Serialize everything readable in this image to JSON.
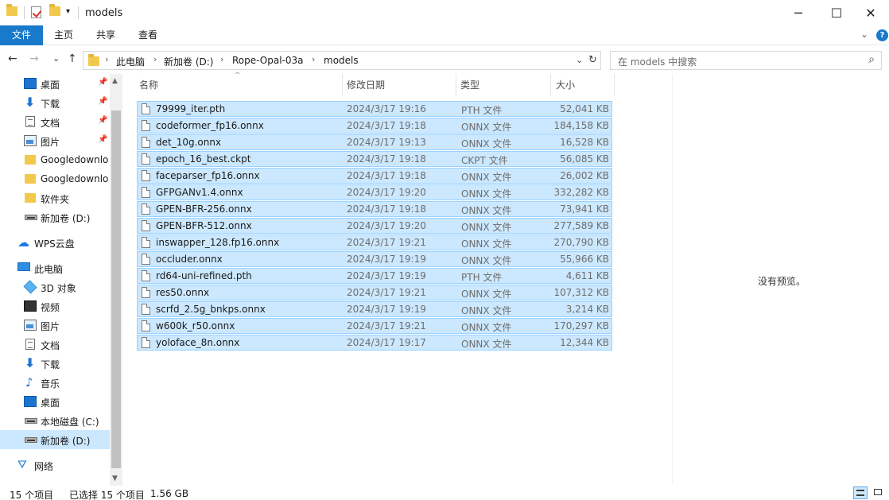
{
  "window": {
    "title": "models",
    "minimize_glyph": "─",
    "maximize_glyph": "☐",
    "close_glyph": "✕"
  },
  "ribbon": {
    "tabs": [
      "文件",
      "主页",
      "共享",
      "查看"
    ],
    "expand_glyph": "⌄",
    "help_glyph": "?"
  },
  "nav": {
    "back_glyph": "←",
    "forward_glyph": "→",
    "recent_glyph": "⌄",
    "up_glyph": "↑",
    "breadcrumbs": [
      "此电脑",
      "新加卷 (D:)",
      "Rope-Opal-03a",
      "models"
    ],
    "crumb_sep": "›",
    "dropdown_glyph": "⌄",
    "refresh_glyph": "↻",
    "search_placeholder": "在 models 中搜索",
    "search_glyph": "⌕"
  },
  "sidebar": {
    "items": [
      {
        "label": "桌面",
        "icon": "desktop-icon",
        "pinned": true
      },
      {
        "label": "下载",
        "icon": "download-icon",
        "pinned": true
      },
      {
        "label": "文档",
        "icon": "document-icon",
        "pinned": true
      },
      {
        "label": "图片",
        "icon": "pictures-icon",
        "pinned": true
      },
      {
        "label": "Googledownlo",
        "icon": "folder-icon",
        "pinned": false
      },
      {
        "label": "Googledownlo",
        "icon": "folder-icon",
        "pinned": false
      },
      {
        "label": "软件夹",
        "icon": "folder-icon",
        "pinned": false
      },
      {
        "label": "新加卷 (D:)",
        "icon": "drive-icon",
        "pinned": false
      },
      {
        "label": "WPS云盘",
        "icon": "cloud-icon",
        "pinned": false
      },
      {
        "label": "此电脑",
        "icon": "computer-icon",
        "pinned": false
      },
      {
        "label": "3D 对象",
        "icon": "3d-objects-icon",
        "pinned": false
      },
      {
        "label": "视频",
        "icon": "video-icon",
        "pinned": false
      },
      {
        "label": "图片",
        "icon": "pictures-icon",
        "pinned": false
      },
      {
        "label": "文档",
        "icon": "document-icon",
        "pinned": false
      },
      {
        "label": "下载",
        "icon": "download-icon",
        "pinned": false
      },
      {
        "label": "音乐",
        "icon": "music-icon",
        "pinned": false
      },
      {
        "label": "桌面",
        "icon": "desktop-icon",
        "pinned": false
      },
      {
        "label": "本地磁盘 (C:)",
        "icon": "drive-icon",
        "pinned": false
      },
      {
        "label": "新加卷 (D:)",
        "icon": "drive-icon",
        "pinned": false,
        "selected": true
      },
      {
        "label": "网络",
        "icon": "network-icon",
        "pinned": false
      }
    ],
    "pin_glyph": "📌"
  },
  "columns": {
    "name": "名称",
    "date": "修改日期",
    "type": "类型",
    "size": "大小",
    "sort_glyph": "^"
  },
  "files": [
    {
      "name": "79999_iter.pth",
      "date": "2024/3/17 19:16",
      "type": "PTH 文件",
      "size": "52,041 KB"
    },
    {
      "name": "codeformer_fp16.onnx",
      "date": "2024/3/17 19:18",
      "type": "ONNX 文件",
      "size": "184,158 KB"
    },
    {
      "name": "det_10g.onnx",
      "date": "2024/3/17 19:13",
      "type": "ONNX 文件",
      "size": "16,528 KB"
    },
    {
      "name": "epoch_16_best.ckpt",
      "date": "2024/3/17 19:18",
      "type": "CKPT 文件",
      "size": "56,085 KB"
    },
    {
      "name": "faceparser_fp16.onnx",
      "date": "2024/3/17 19:18",
      "type": "ONNX 文件",
      "size": "26,002 KB"
    },
    {
      "name": "GFPGANv1.4.onnx",
      "date": "2024/3/17 19:20",
      "type": "ONNX 文件",
      "size": "332,282 KB"
    },
    {
      "name": "GPEN-BFR-256.onnx",
      "date": "2024/3/17 19:18",
      "type": "ONNX 文件",
      "size": "73,941 KB"
    },
    {
      "name": "GPEN-BFR-512.onnx",
      "date": "2024/3/17 19:20",
      "type": "ONNX 文件",
      "size": "277,589 KB"
    },
    {
      "name": "inswapper_128.fp16.onnx",
      "date": "2024/3/17 19:21",
      "type": "ONNX 文件",
      "size": "270,790 KB"
    },
    {
      "name": "occluder.onnx",
      "date": "2024/3/17 19:19",
      "type": "ONNX 文件",
      "size": "55,966 KB"
    },
    {
      "name": "rd64-uni-refined.pth",
      "date": "2024/3/17 19:19",
      "type": "PTH 文件",
      "size": "4,611 KB"
    },
    {
      "name": "res50.onnx",
      "date": "2024/3/17 19:21",
      "type": "ONNX 文件",
      "size": "107,312 KB"
    },
    {
      "name": "scrfd_2.5g_bnkps.onnx",
      "date": "2024/3/17 19:19",
      "type": "ONNX 文件",
      "size": "3,214 KB"
    },
    {
      "name": "w600k_r50.onnx",
      "date": "2024/3/17 19:21",
      "type": "ONNX 文件",
      "size": "170,297 KB"
    },
    {
      "name": "yoloface_8n.onnx",
      "date": "2024/3/17 19:17",
      "type": "ONNX 文件",
      "size": "12,344 KB"
    }
  ],
  "preview": {
    "message": "没有预览。"
  },
  "status": {
    "item_count": "15 个项目",
    "selected": "已选择 15 个项目",
    "selected_size": "1.56 GB"
  },
  "colors": {
    "accent": "#1979ca",
    "selection": "#cce8ff",
    "selection_border": "#99d1ff"
  }
}
